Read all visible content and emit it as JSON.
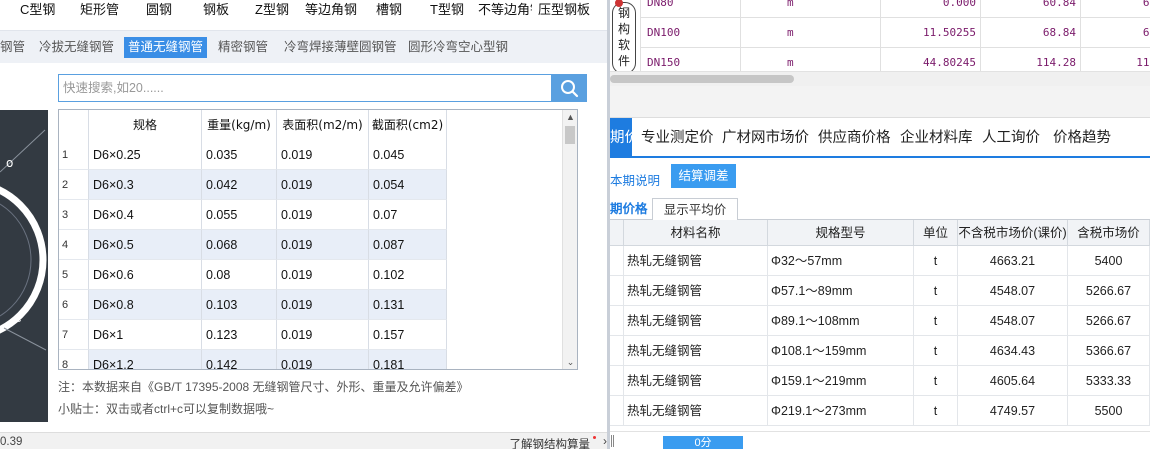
{
  "left": {
    "top_categories": [
      "C型钢",
      "矩形管",
      "圆钢",
      "钢板",
      "Z型钢",
      "等边角钢",
      "槽钢",
      "T型钢",
      "不等边角钢",
      "压型钢板"
    ],
    "sub_categories": [
      {
        "label": "钢管",
        "active": false
      },
      {
        "label": "冷拔无缝钢管",
        "active": false
      },
      {
        "label": "普通无缝钢管",
        "active": true
      },
      {
        "label": "精密钢管",
        "active": false
      },
      {
        "label": "冷弯焊接薄壁圆钢管",
        "active": false
      },
      {
        "label": "圆形冷弯空心型钢",
        "active": false
      }
    ],
    "search": {
      "placeholder": "快速搜索,如20......"
    },
    "table": {
      "headers": [
        "规格",
        "重量(kg/m)",
        "表面积(m2/m)",
        "截面积(cm2)"
      ],
      "rows": [
        {
          "n": "1",
          "spec": "D6×0.25",
          "weight": "0.035",
          "area": "0.019",
          "section": "0.045"
        },
        {
          "n": "2",
          "spec": "D6×0.3",
          "weight": "0.042",
          "area": "0.019",
          "section": "0.054"
        },
        {
          "n": "3",
          "spec": "D6×0.4",
          "weight": "0.055",
          "area": "0.019",
          "section": "0.07"
        },
        {
          "n": "4",
          "spec": "D6×0.5",
          "weight": "0.068",
          "area": "0.019",
          "section": "0.087"
        },
        {
          "n": "5",
          "spec": "D6×0.6",
          "weight": "0.08",
          "area": "0.019",
          "section": "0.102"
        },
        {
          "n": "6",
          "spec": "D6×0.8",
          "weight": "0.103",
          "area": "0.019",
          "section": "0.131"
        },
        {
          "n": "7",
          "spec": "D6×1",
          "weight": "0.123",
          "area": "0.019",
          "section": "0.157"
        },
        {
          "n": "8",
          "spec": "D6×1.2",
          "weight": "0.142",
          "area": "0.019",
          "section": "0.181"
        }
      ]
    },
    "note": "注：本数据来自《GB/T  17395-2008  无缝钢管尺寸、外形、重量及允许偏差》",
    "tip": "小贴士：双击或者ctrl+c可以复制数据哦~",
    "footer_number": "0.39",
    "footer_link": "了解钢结构算量"
  },
  "right": {
    "badge": "钢构软件",
    "dn_rows": [
      {
        "dn": "DN80",
        "unit": "m",
        "v1": "0.000",
        "v2": "60.84",
        "v3": "60.84"
      },
      {
        "dn": "DN100",
        "unit": "m",
        "v1": "11.50255",
        "v2": "68.84",
        "v3": "68.84"
      },
      {
        "dn": "DN150",
        "unit": "m",
        "v1": "44.80245",
        "v2": "114.28",
        "v3": "114.28"
      }
    ],
    "tabs": [
      {
        "label": "期价",
        "active": true
      },
      {
        "label": "专业测定价",
        "active": false
      },
      {
        "label": "广材网市场价",
        "active": false
      },
      {
        "label": "供应商价格",
        "active": false
      },
      {
        "label": "企业材料库",
        "active": false
      },
      {
        "label": "人工询价",
        "active": false
      },
      {
        "label": "价格趋势",
        "active": false
      }
    ],
    "period_note": "本期说明",
    "settle_button": "结算调差",
    "subtab_active": "期价格",
    "subtab_avg": "显示平均价",
    "price_table": {
      "headers": [
        "材料名称",
        "规格型号",
        "单位",
        "不含税市场价(课价)",
        "含税市场价"
      ],
      "rows": [
        {
          "name": "热轧无缝钢管",
          "spec": "Φ32～57mm",
          "unit": "t",
          "excl": "4663.21",
          "incl": "5400"
        },
        {
          "name": "热轧无缝钢管",
          "spec": "Φ57.1～89mm",
          "unit": "t",
          "excl": "4548.07",
          "incl": "5266.67"
        },
        {
          "name": "热轧无缝钢管",
          "spec": "Φ89.1～108mm",
          "unit": "t",
          "excl": "4548.07",
          "incl": "5266.67"
        },
        {
          "name": "热轧无缝钢管",
          "spec": "Φ108.1～159mm",
          "unit": "t",
          "excl": "4634.43",
          "incl": "5366.67"
        },
        {
          "name": "热轧无缝钢管",
          "spec": "Φ159.1～219mm",
          "unit": "t",
          "excl": "4605.64",
          "incl": "5333.33"
        },
        {
          "name": "热轧无缝钢管",
          "spec": "Φ219.1～273mm",
          "unit": "t",
          "excl": "4749.57",
          "incl": "5500"
        }
      ]
    },
    "footer_button": "0分"
  }
}
